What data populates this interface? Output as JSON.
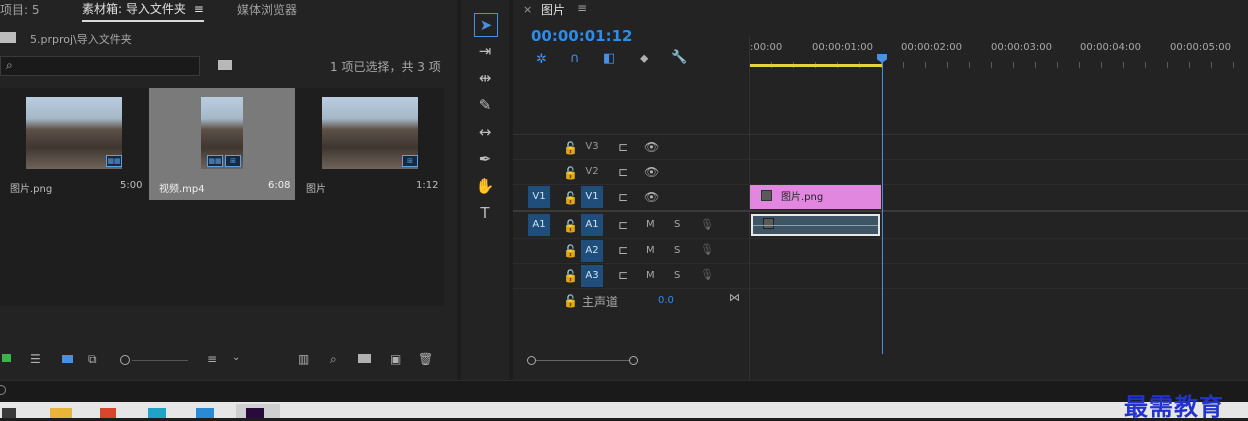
{
  "project_panel": {
    "tab_project": "项目: 5",
    "tab_bin": "素材箱: 导入文件夹",
    "tab_bin_menu": "≡",
    "tab_media_browser": "媒体浏览器",
    "path": "5.prproj\\导入文件夹",
    "selection_status": "1 项已选择，共 3 项",
    "search_placeholder": "",
    "items": [
      {
        "name": "图片.png",
        "duration": "5:00"
      },
      {
        "name": "视频.mp4",
        "duration": "6:08"
      },
      {
        "name": "图片",
        "duration": "1:12"
      }
    ]
  },
  "timeline": {
    "tab_close": "×",
    "tab_title": "图片",
    "tab_menu": "≡",
    "timecode": "00:00:01:12",
    "ruler_ticks": [
      ":00:00",
      "00:00:01:00",
      "00:00:02:00",
      "00:00:03:00",
      "00:00:04:00",
      "00:00:05:00"
    ],
    "video_tracks": [
      {
        "source": "",
        "label": "V3"
      },
      {
        "source": "",
        "label": "V2"
      },
      {
        "source": "V1",
        "label": "V1"
      }
    ],
    "audio_tracks": [
      {
        "source": "A1",
        "label": "A1",
        "mute": "M",
        "solo": "S"
      },
      {
        "source": "",
        "label": "A2",
        "mute": "M",
        "solo": "S"
      },
      {
        "source": "",
        "label": "A3",
        "mute": "M",
        "solo": "S"
      }
    ],
    "master_label": "主声道",
    "master_value": "0.0",
    "video_clip_label": "图片.png",
    "playhead_time": "00:00:01:12"
  },
  "watermark": "最需教育",
  "colors": {
    "accent_blue": "#2d8ceb",
    "track_target": "#1f4e7a",
    "video_clip": "#e187e0",
    "audio_clip": "#3e5566",
    "playhead": "#4a90e2",
    "work_area": "#e5d33b"
  }
}
